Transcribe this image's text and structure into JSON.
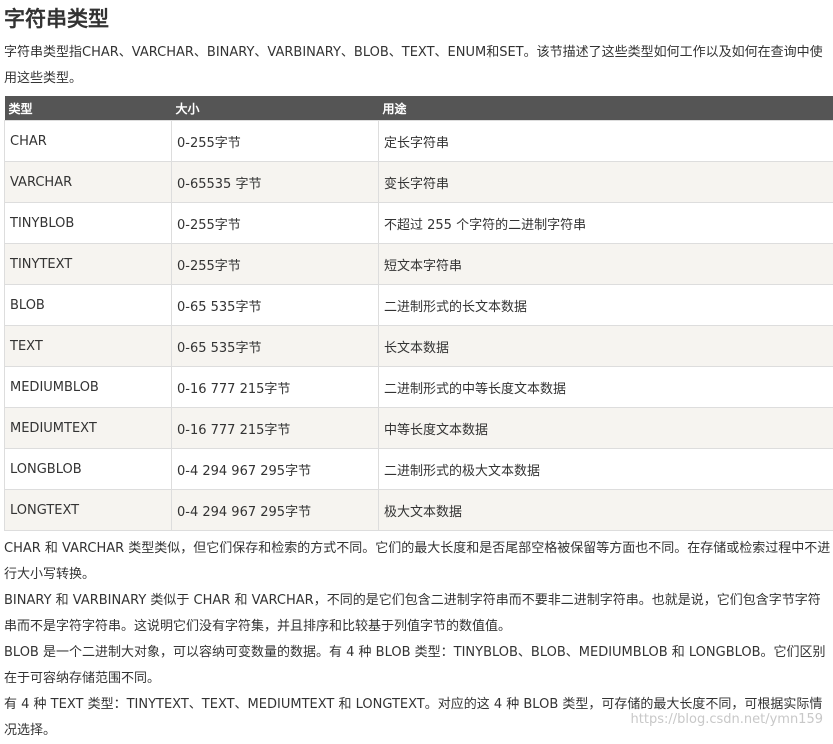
{
  "page_title": "字符串类型",
  "intro": "字符串类型指CHAR、VARCHAR、BINARY、VARBINARY、BLOB、TEXT、ENUM和SET。该节描述了这些类型如何工作以及如何在查询中使用这些类型。",
  "table": {
    "headers": [
      "类型",
      "大小",
      "用途"
    ],
    "rows": [
      {
        "type": "CHAR",
        "size": "0-255字节",
        "usage": "定长字符串"
      },
      {
        "type": "VARCHAR",
        "size": "0-65535 字节",
        "usage": "变长字符串"
      },
      {
        "type": "TINYBLOB",
        "size": "0-255字节",
        "usage": "不超过 255 个字符的二进制字符串"
      },
      {
        "type": "TINYTEXT",
        "size": "0-255字节",
        "usage": "短文本字符串"
      },
      {
        "type": "BLOB",
        "size": "0-65 535字节",
        "usage": "二进制形式的长文本数据"
      },
      {
        "type": "TEXT",
        "size": "0-65 535字节",
        "usage": "长文本数据"
      },
      {
        "type": "MEDIUMBLOB",
        "size": "0-16 777 215字节",
        "usage": "二进制形式的中等长度文本数据"
      },
      {
        "type": "MEDIUMTEXT",
        "size": "0-16 777 215字节",
        "usage": "中等长度文本数据"
      },
      {
        "type": "LONGBLOB",
        "size": "0-4 294 967 295字节",
        "usage": "二进制形式的极大文本数据"
      },
      {
        "type": "LONGTEXT",
        "size": "0-4 294 967 295字节",
        "usage": "极大文本数据"
      }
    ]
  },
  "notes": [
    "CHAR 和 VARCHAR 类型类似，但它们保存和检索的方式不同。它们的最大长度和是否尾部空格被保留等方面也不同。在存储或检索过程中不进行大小写转换。",
    "BINARY 和 VARBINARY 类似于 CHAR 和 VARCHAR，不同的是它们包含二进制字符串而不要非二进制字符串。也就是说，它们包含字节字符串而不是字符字符串。这说明它们没有字符集，并且排序和比较基于列值字节的数值值。",
    "BLOB 是一个二进制大对象，可以容纳可变数量的数据。有 4 种 BLOB 类型：TINYBLOB、BLOB、MEDIUMBLOB 和 LONGBLOB。它们区别在于可容纳存储范围不同。",
    "有 4 种 TEXT 类型：TINYTEXT、TEXT、MEDIUMTEXT 和 LONGTEXT。对应的这 4 种 BLOB 类型，可存储的最大长度不同，可根据实际情况选择。"
  ],
  "watermark": "https://blog.csdn.net/ymn159"
}
